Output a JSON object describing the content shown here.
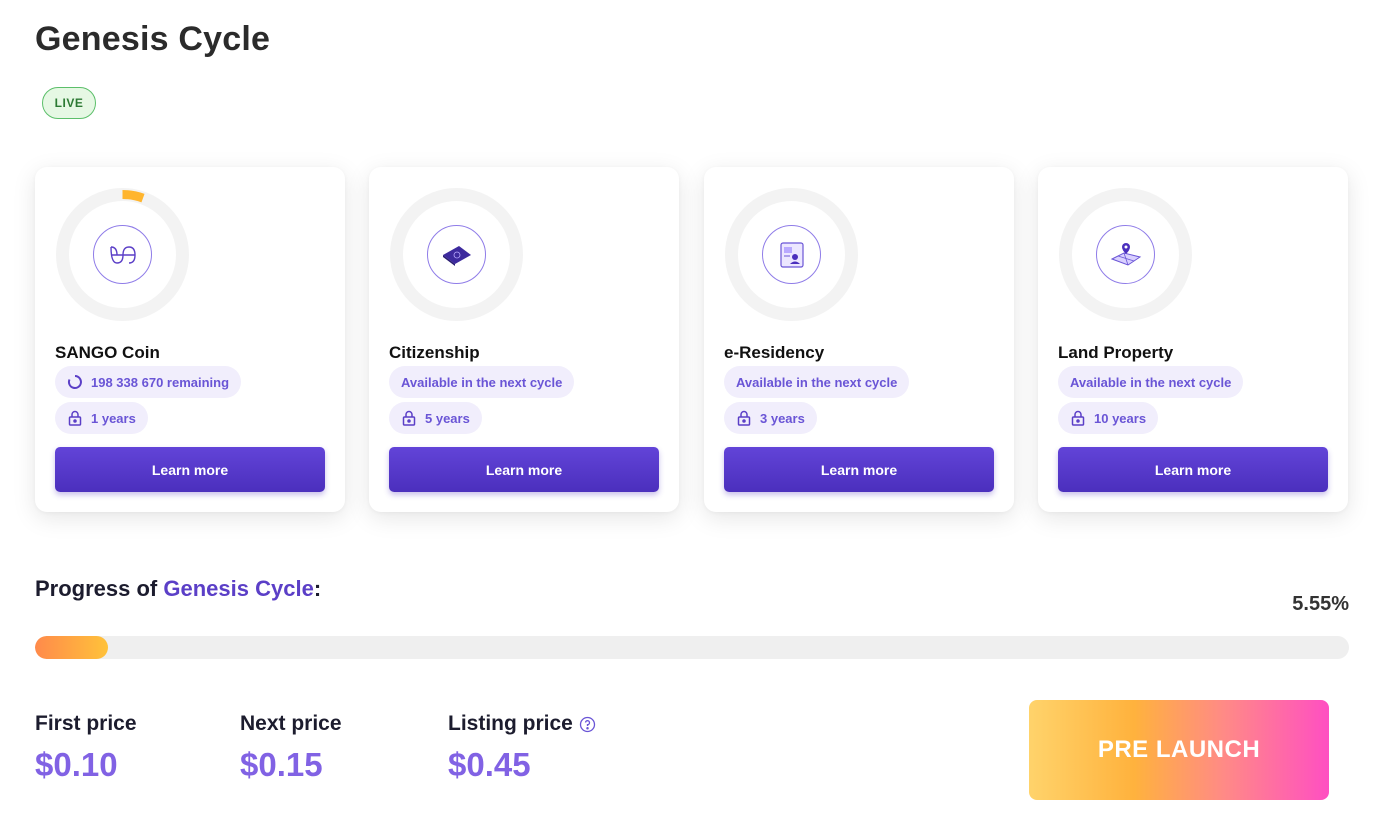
{
  "page": {
    "title": "Genesis Cycle",
    "status_badge": "LIVE"
  },
  "cards": [
    {
      "title": "SANGO Coin",
      "icon": "sango-logo-icon",
      "pill1_text": "198 338 670 remaining",
      "pill1_icon": "spinner-icon",
      "lock_text": "1 years",
      "button_label": "Learn more",
      "ring_progress": 0.0555
    },
    {
      "title": "Citizenship",
      "icon": "passport-icon",
      "pill1_text": "Available in the next cycle",
      "lock_text": "5 years",
      "button_label": "Learn more",
      "ring_progress": 0
    },
    {
      "title": "e-Residency",
      "icon": "id-card-icon",
      "pill1_text": "Available in the next cycle",
      "lock_text": "3 years",
      "button_label": "Learn more",
      "ring_progress": 0
    },
    {
      "title": "Land Property",
      "icon": "land-map-icon",
      "pill1_text": "Available in the next cycle",
      "lock_text": "10 years",
      "button_label": "Learn more",
      "ring_progress": 0
    }
  ],
  "progress": {
    "label_prefix": "Progress of",
    "label_accent": "Genesis Cycle",
    "label_suffix": ":",
    "percent_text": "5.55%",
    "fraction": 0.0555
  },
  "prices": {
    "first_label": "First price",
    "first_value": "$0.10",
    "next_label": "Next price",
    "next_value": "$0.15",
    "listing_label": "Listing price",
    "listing_value": "$0.45"
  },
  "cta": {
    "label": "PRE LAUNCH"
  },
  "colors": {
    "accent_purple": "#5b3fc7",
    "price_purple": "#8162e4",
    "ring_highlight": "#ffb52e",
    "live_green": "#2d7a34"
  }
}
